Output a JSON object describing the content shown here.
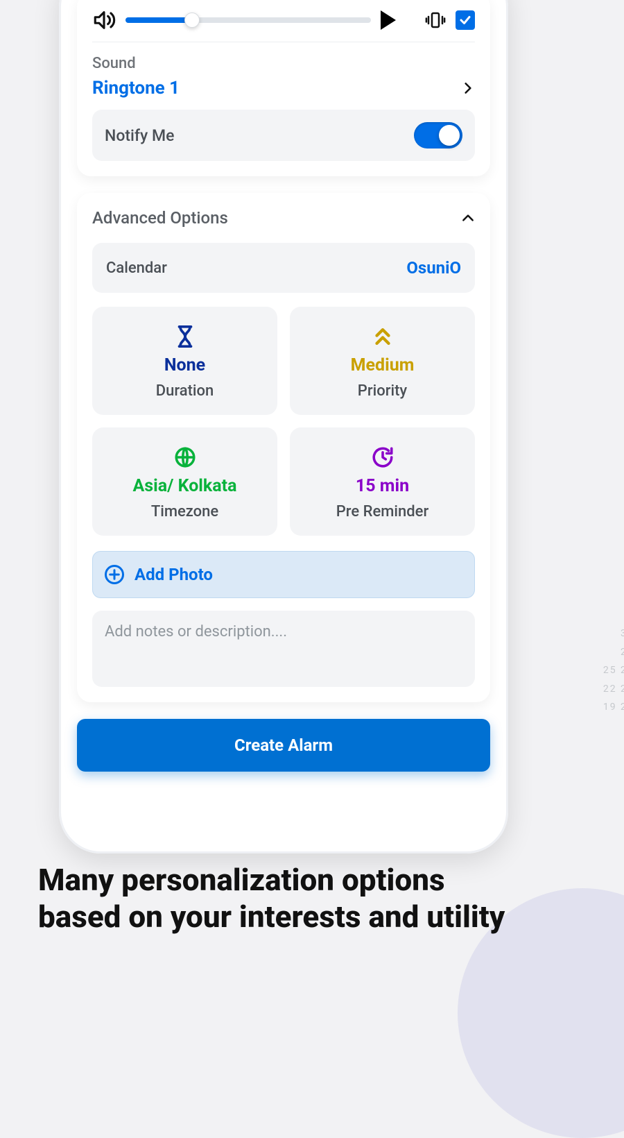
{
  "sound": {
    "label": "Sound",
    "ringtone": "Ringtone 1",
    "notify_label": "Notify Me",
    "notify_on": true,
    "vibrate_checked": true,
    "volume_percent": 28
  },
  "advanced": {
    "title": "Advanced Options",
    "calendar": {
      "label": "Calendar",
      "value": "OsuniO"
    },
    "tiles": {
      "duration": {
        "value": "None",
        "label": "Duration",
        "color": "#0a2f9b"
      },
      "priority": {
        "value": "Medium",
        "label": "Priority",
        "color": "#c9a000"
      },
      "timezone": {
        "value": "Asia/ Kolkata",
        "label": "Timezone",
        "color": "#08b23b"
      },
      "prereminder": {
        "value": "15 min",
        "label": "Pre Reminder",
        "color": "#8a00c9"
      }
    },
    "add_photo": "Add Photo",
    "notes_placeholder": "Add notes or description...."
  },
  "create_button": "Create Alarm",
  "marketing_copy": "Many personalization options based on your interests and utility"
}
